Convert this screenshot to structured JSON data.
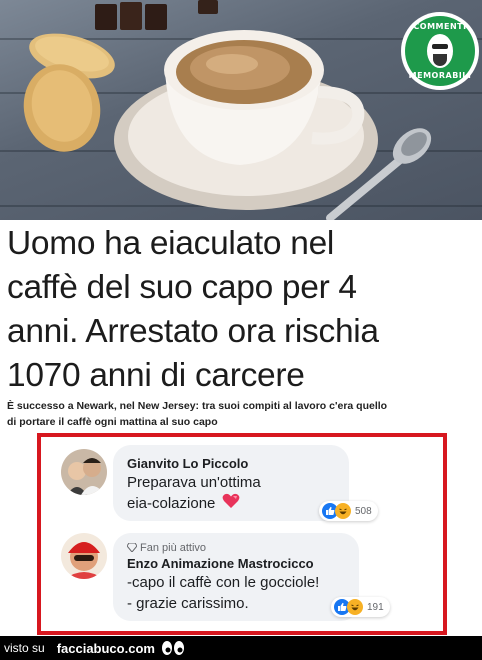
{
  "badge": {
    "top_text": "COMMENTI",
    "bottom_text": "MEMORABILI"
  },
  "headline": {
    "lines": [
      "Uomo ha eiaculato nel",
      "caffè del suo capo per 4",
      "anni. Arrestato ora rischia",
      "1070 anni di carcere"
    ]
  },
  "subtitle": {
    "lines": [
      "È successo a Newark, nel New Jersey: tra suoi compiti al lavoro c'era quello",
      "di portare il caffè ogni mattina al suo capo"
    ]
  },
  "comments": [
    {
      "author": "Gianvito Lo Piccolo",
      "tag": "",
      "text_lines": [
        "Preparava un'ottima",
        "eia-colazione"
      ],
      "emoji": "heart",
      "reactions": [
        "like",
        "haha"
      ],
      "reaction_count": "508"
    },
    {
      "author": "Enzo Animazione Mastrocicco",
      "tag": "Fan più attivo",
      "text_lines": [
        "-capo il caffè con le gocciole!",
        "- grazie carissimo."
      ],
      "emoji": "",
      "reactions": [
        "like",
        "haha"
      ],
      "reaction_count": "191"
    }
  ],
  "footer": {
    "visto": "visto su",
    "site": "facciabuco.com"
  },
  "colors": {
    "frame": "#d7171f",
    "badge": "#1e9a4b",
    "like": "#1877f2",
    "haha": "#f7b125"
  }
}
